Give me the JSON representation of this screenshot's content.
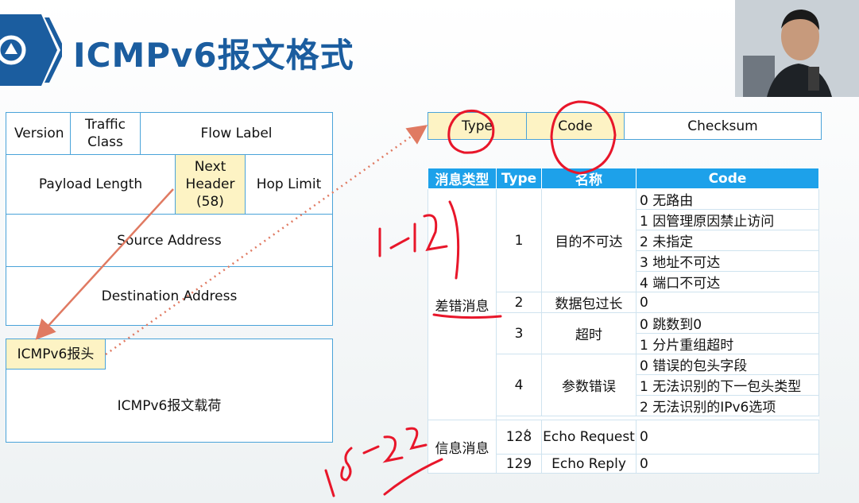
{
  "title": "ICMPv6报文格式",
  "ipv6_header": {
    "version": "Version",
    "traffic_class": "Traffic Class",
    "flow_label": "Flow Label",
    "payload_length": "Payload Length",
    "next_header": "Next Header (58)",
    "hop_limit": "Hop Limit",
    "source_address": "Source Address",
    "destination_address": "Destination Address"
  },
  "icmpv6": {
    "header_label": "ICMPv6报头",
    "payload_label": "ICMPv6报文载荷"
  },
  "icmp_header": {
    "type": "Type",
    "code": "Code",
    "checksum": "Checksum"
  },
  "code_table": {
    "headers": [
      "消息类型",
      "Type",
      "名称",
      "Code"
    ],
    "groups": [
      {
        "category": "差错消息",
        "entries": [
          {
            "type": "1",
            "name": "目的不可达",
            "codes": [
              "0 无路由",
              "1 因管理原因禁止访问",
              "2 未指定",
              "3 地址不可达",
              "4 端口不可达"
            ]
          },
          {
            "type": "2",
            "name": "数据包过长",
            "codes": [
              "0"
            ]
          },
          {
            "type": "3",
            "name": "超时",
            "codes": [
              "0 跳数到0",
              "1 分片重组超时"
            ]
          },
          {
            "type": "4",
            "name": "参数错误",
            "codes": [
              "0 错误的包头字段",
              "1 无法识别的下一包头类型",
              "2 无法识别的IPv6选项"
            ]
          }
        ]
      },
      {
        "category": "信息消息",
        "entries": [
          {
            "type": "128",
            "name": "Echo Request",
            "codes": [
              "0"
            ]
          },
          {
            "type": "129",
            "name": "Echo Reply",
            "codes": [
              "0"
            ]
          }
        ]
      }
    ]
  },
  "colors": {
    "title": "#1b5d9f",
    "logo": "#1b5d9f",
    "table_header": "#1da1ea",
    "cell_border": "#4aa3d9",
    "highlight": "#fdf3c4",
    "annotation": "#e8162a",
    "arrow": "#e07a62"
  }
}
